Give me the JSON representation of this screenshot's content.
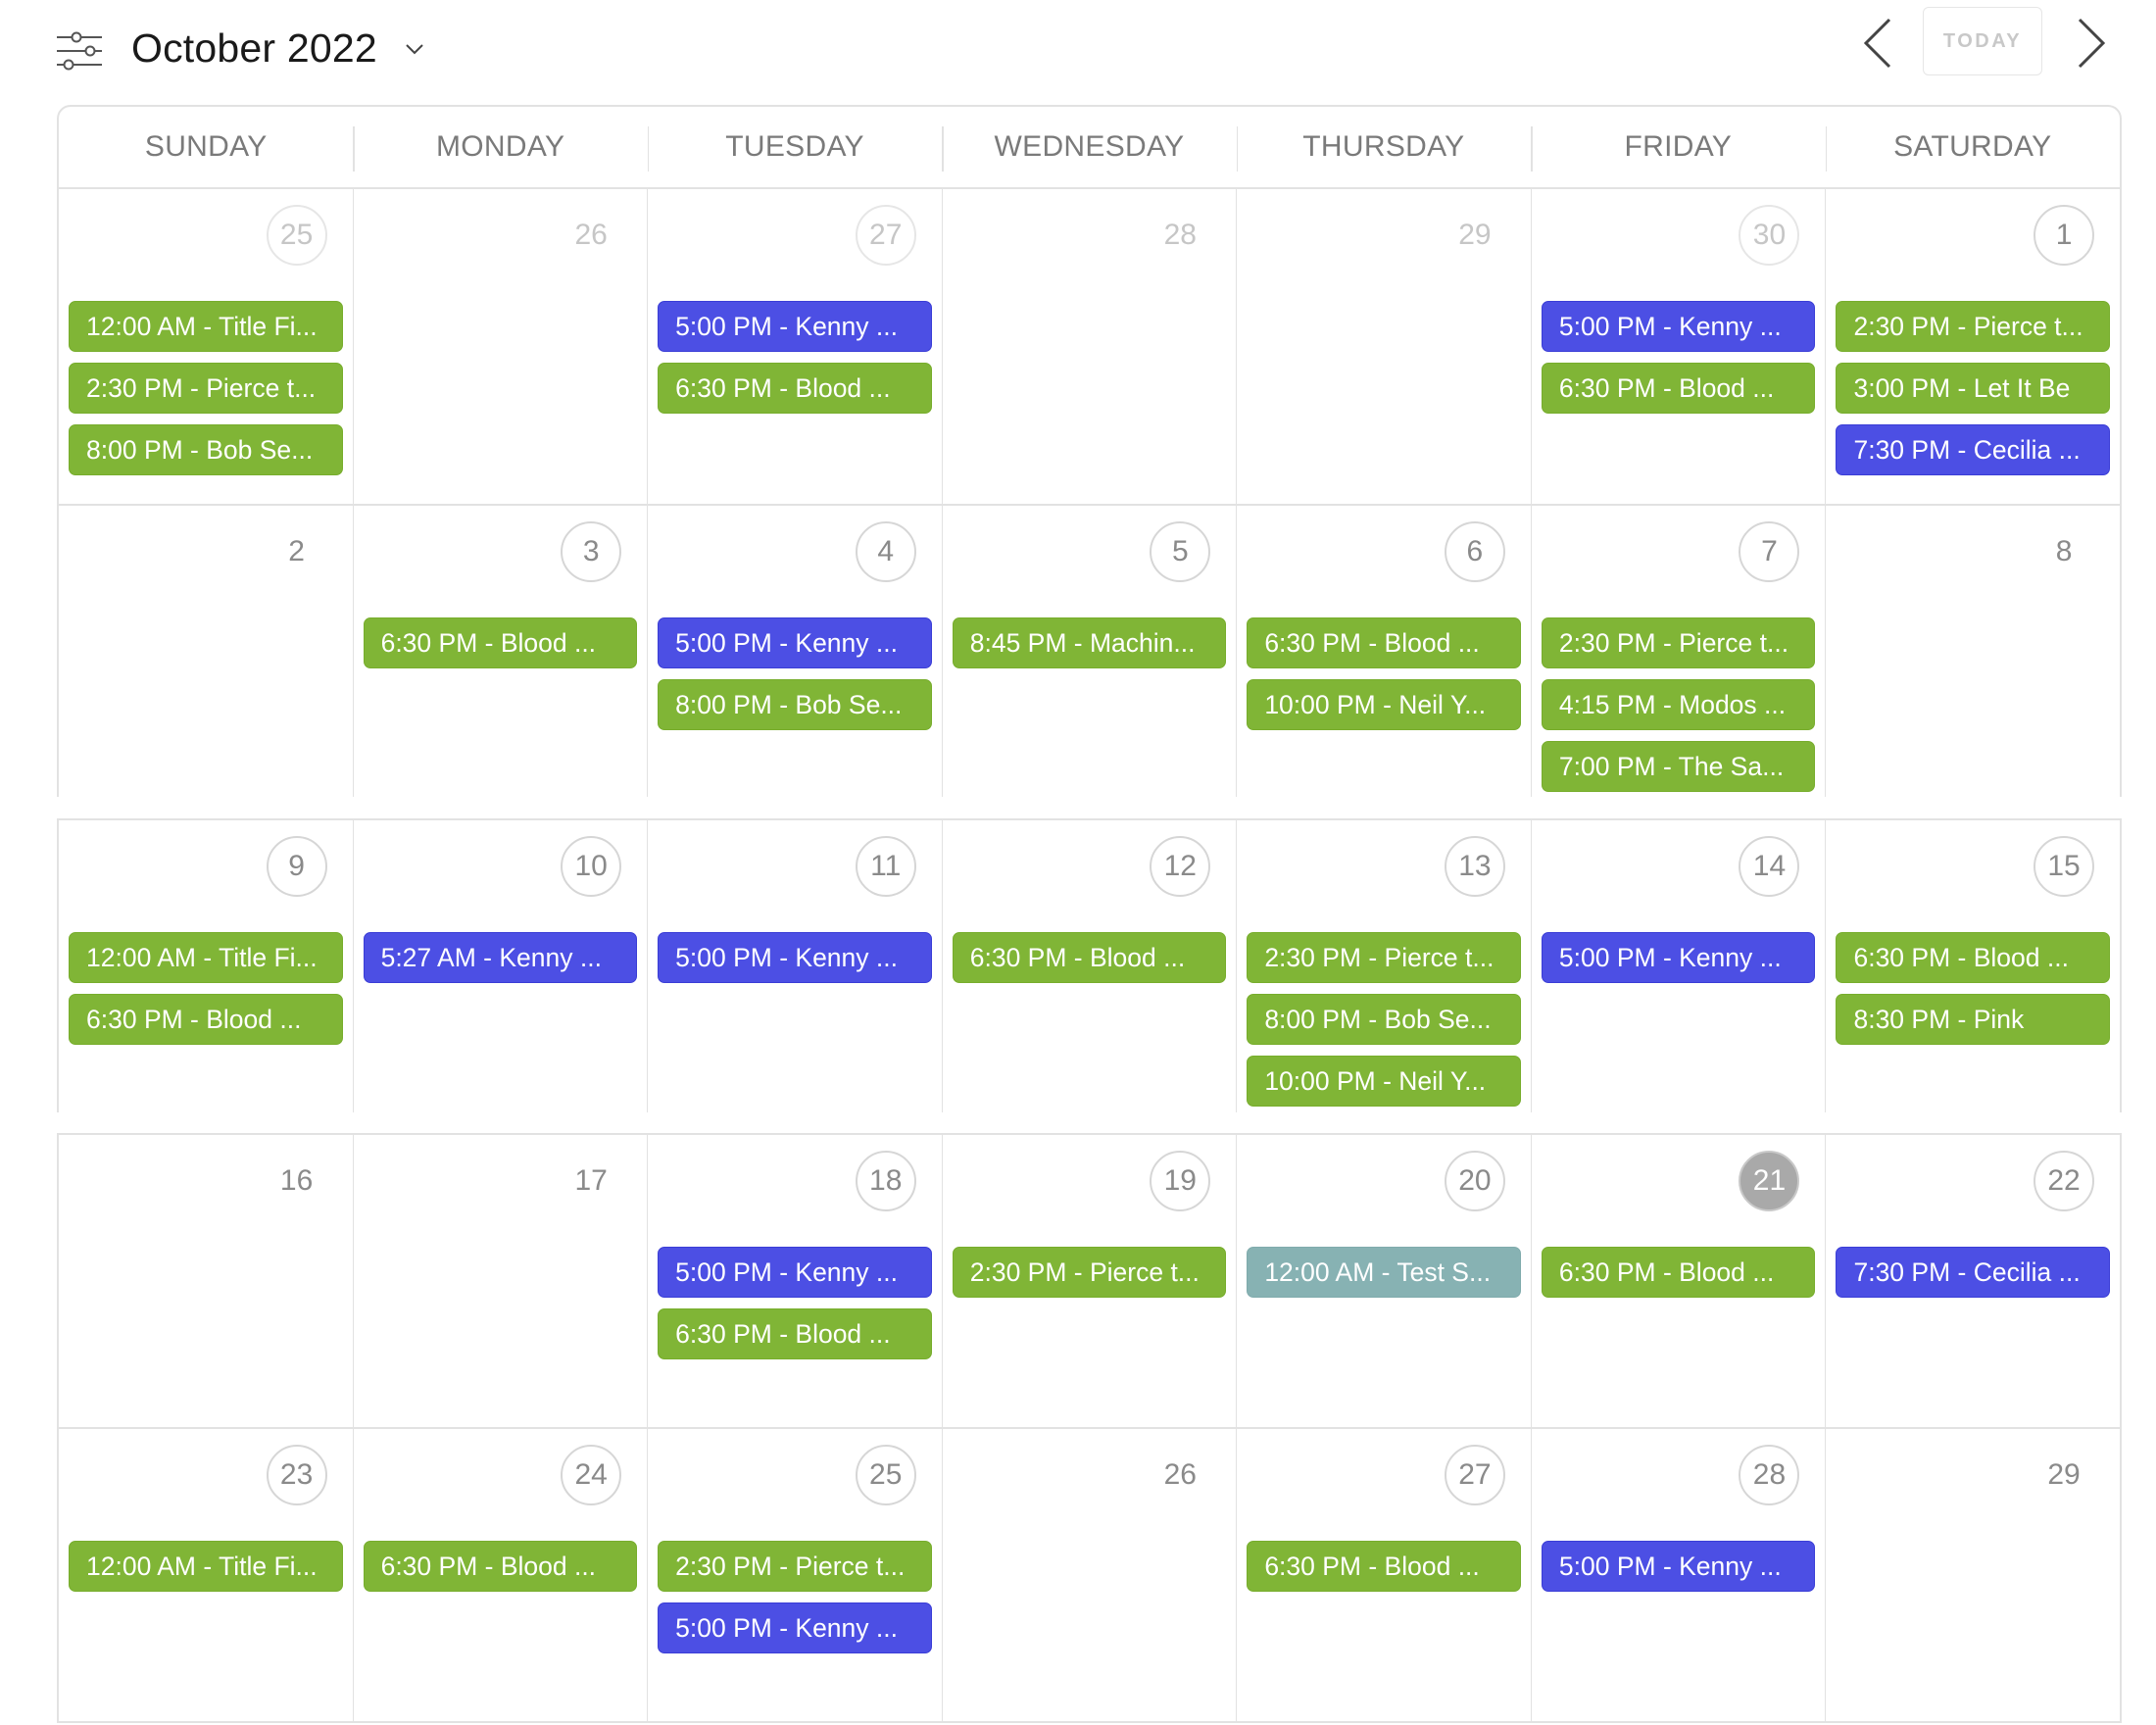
{
  "header": {
    "title": "October 2022",
    "filter_icon": "sliders-icon",
    "dropdown_icon": "chevron-down-icon",
    "prev_icon": "chevron-left-icon",
    "next_icon": "chevron-right-icon",
    "today_label": "TODAY"
  },
  "colors": {
    "green": "#80b536",
    "blue": "#4c4fe4",
    "teal": "#87b2b3",
    "today_circle": "#a9a9a9",
    "grid_line": "#e2e2e2"
  },
  "weekdays": [
    "SUNDAY",
    "MONDAY",
    "TUESDAY",
    "WEDNESDAY",
    "THURSDAY",
    "FRIDAY",
    "SATURDAY"
  ],
  "weeks": [
    {
      "days": [
        {
          "num": "25",
          "muted": true,
          "circle": true,
          "events": [
            {
              "text": "12:00 AM - Title Fi...",
              "color": "green"
            },
            {
              "text": "2:30 PM - Pierce t...",
              "color": "green"
            },
            {
              "text": "8:00 PM - Bob Se...",
              "color": "green"
            }
          ]
        },
        {
          "num": "26",
          "muted": true,
          "circle": false,
          "events": []
        },
        {
          "num": "27",
          "muted": true,
          "circle": true,
          "events": [
            {
              "text": "5:00 PM - Kenny ...",
              "color": "blue"
            },
            {
              "text": "6:30 PM - Blood ...",
              "color": "green"
            }
          ]
        },
        {
          "num": "28",
          "muted": true,
          "circle": false,
          "events": []
        },
        {
          "num": "29",
          "muted": true,
          "circle": false,
          "events": []
        },
        {
          "num": "30",
          "muted": true,
          "circle": true,
          "events": [
            {
              "text": "5:00 PM - Kenny ...",
              "color": "blue"
            },
            {
              "text": "6:30 PM - Blood ...",
              "color": "green"
            }
          ]
        },
        {
          "num": "1",
          "muted": false,
          "circle": true,
          "events": [
            {
              "text": "2:30 PM - Pierce t...",
              "color": "green"
            },
            {
              "text": "3:00 PM - Let It Be",
              "color": "green"
            },
            {
              "text": "7:30 PM - Cecilia ...",
              "color": "blue"
            }
          ]
        }
      ]
    },
    {
      "days": [
        {
          "num": "2",
          "muted": false,
          "circle": false,
          "events": []
        },
        {
          "num": "3",
          "muted": false,
          "circle": true,
          "events": [
            {
              "text": "6:30 PM - Blood ...",
              "color": "green"
            }
          ]
        },
        {
          "num": "4",
          "muted": false,
          "circle": true,
          "events": [
            {
              "text": "5:00 PM - Kenny ...",
              "color": "blue"
            },
            {
              "text": "8:00 PM - Bob Se...",
              "color": "green"
            }
          ]
        },
        {
          "num": "5",
          "muted": false,
          "circle": true,
          "events": [
            {
              "text": "8:45 PM - Machin...",
              "color": "green"
            }
          ]
        },
        {
          "num": "6",
          "muted": false,
          "circle": true,
          "events": [
            {
              "text": "6:30 PM - Blood ...",
              "color": "green"
            },
            {
              "text": "10:00 PM - Neil Y...",
              "color": "green"
            }
          ]
        },
        {
          "num": "7",
          "muted": false,
          "circle": true,
          "events": [
            {
              "text": "2:30 PM - Pierce t...",
              "color": "green"
            },
            {
              "text": "4:15 PM - Modos ...",
              "color": "green"
            },
            {
              "text": "7:00 PM - The Sa...",
              "color": "green"
            }
          ]
        },
        {
          "num": "8",
          "muted": false,
          "circle": false,
          "events": []
        }
      ]
    },
    {
      "days": [
        {
          "num": "9",
          "muted": false,
          "circle": true,
          "events": [
            {
              "text": "12:00 AM - Title Fi...",
              "color": "green"
            },
            {
              "text": "6:30 PM - Blood ...",
              "color": "green"
            }
          ]
        },
        {
          "num": "10",
          "muted": false,
          "circle": true,
          "events": [
            {
              "text": "5:27 AM - Kenny ...",
              "color": "blue"
            }
          ]
        },
        {
          "num": "11",
          "muted": false,
          "circle": true,
          "events": [
            {
              "text": "5:00 PM - Kenny ...",
              "color": "blue"
            }
          ]
        },
        {
          "num": "12",
          "muted": false,
          "circle": true,
          "events": [
            {
              "text": "6:30 PM - Blood ...",
              "color": "green"
            }
          ]
        },
        {
          "num": "13",
          "muted": false,
          "circle": true,
          "events": [
            {
              "text": "2:30 PM - Pierce t...",
              "color": "green"
            },
            {
              "text": "8:00 PM - Bob Se...",
              "color": "green"
            },
            {
              "text": "10:00 PM - Neil Y...",
              "color": "green"
            }
          ]
        },
        {
          "num": "14",
          "muted": false,
          "circle": true,
          "events": [
            {
              "text": "5:00 PM - Kenny ...",
              "color": "blue"
            }
          ]
        },
        {
          "num": "15",
          "muted": false,
          "circle": true,
          "events": [
            {
              "text": "6:30 PM - Blood ...",
              "color": "green"
            },
            {
              "text": "8:30 PM - Pink",
              "color": "green"
            }
          ]
        }
      ]
    },
    {
      "days": [
        {
          "num": "16",
          "muted": false,
          "circle": false,
          "events": []
        },
        {
          "num": "17",
          "muted": false,
          "circle": false,
          "events": []
        },
        {
          "num": "18",
          "muted": false,
          "circle": true,
          "events": [
            {
              "text": "5:00 PM - Kenny ...",
              "color": "blue"
            },
            {
              "text": "6:30 PM - Blood ...",
              "color": "green"
            }
          ]
        },
        {
          "num": "19",
          "muted": false,
          "circle": true,
          "events": [
            {
              "text": "2:30 PM - Pierce t...",
              "color": "green"
            }
          ]
        },
        {
          "num": "20",
          "muted": false,
          "circle": true,
          "events": [
            {
              "text": "12:00 AM - Test S...",
              "color": "teal"
            }
          ]
        },
        {
          "num": "21",
          "muted": false,
          "circle": true,
          "today": true,
          "events": [
            {
              "text": "6:30 PM - Blood ...",
              "color": "green"
            }
          ]
        },
        {
          "num": "22",
          "muted": false,
          "circle": true,
          "events": [
            {
              "text": "7:30 PM - Cecilia ...",
              "color": "blue"
            }
          ]
        }
      ]
    },
    {
      "days": [
        {
          "num": "23",
          "muted": false,
          "circle": true,
          "events": [
            {
              "text": "12:00 AM - Title Fi...",
              "color": "green"
            }
          ]
        },
        {
          "num": "24",
          "muted": false,
          "circle": true,
          "events": [
            {
              "text": "6:30 PM - Blood ...",
              "color": "green"
            }
          ]
        },
        {
          "num": "25",
          "muted": false,
          "circle": true,
          "events": [
            {
              "text": "2:30 PM - Pierce t...",
              "color": "green"
            },
            {
              "text": "5:00 PM - Kenny ...",
              "color": "blue"
            }
          ]
        },
        {
          "num": "26",
          "muted": false,
          "circle": false,
          "events": []
        },
        {
          "num": "27",
          "muted": false,
          "circle": true,
          "events": [
            {
              "text": "6:30 PM - Blood ...",
              "color": "green"
            }
          ]
        },
        {
          "num": "28",
          "muted": false,
          "circle": true,
          "events": [
            {
              "text": "5:00 PM - Kenny ...",
              "color": "blue"
            }
          ]
        },
        {
          "num": "29",
          "muted": false,
          "circle": false,
          "events": []
        }
      ]
    }
  ]
}
